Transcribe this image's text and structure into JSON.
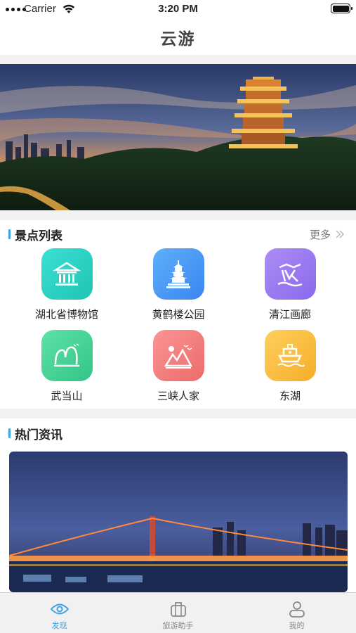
{
  "status_bar": {
    "carrier": "Carrier",
    "time": "3:20 PM"
  },
  "nav": {
    "title": "云游"
  },
  "banner": {
    "pages": 4,
    "active_page": 1
  },
  "attractions": {
    "title": "景点列表",
    "more_label": "更多",
    "items": [
      {
        "name": "湖北省博物馆",
        "icon": "museum-icon",
        "color": "#2fd3c6"
      },
      {
        "name": "黄鹤楼公园",
        "icon": "pagoda-icon",
        "color": "#4a9bf5"
      },
      {
        "name": "清江画廊",
        "icon": "gallery-icon",
        "color": "#9b7bf0"
      },
      {
        "name": "武当山",
        "icon": "mountain-icon",
        "color": "#48d39a"
      },
      {
        "name": "三峡人家",
        "icon": "gorge-icon",
        "color": "#f17d7d"
      },
      {
        "name": "东湖",
        "icon": "boat-icon",
        "color": "#fdbf3c"
      }
    ]
  },
  "news": {
    "title": "热门资讯"
  },
  "tab_bar": {
    "active": "发现",
    "tabs": [
      {
        "label": "发现",
        "icon": "eye-icon"
      },
      {
        "label": "旅游助手",
        "icon": "suitcase-icon"
      },
      {
        "label": "我的",
        "icon": "user-icon"
      }
    ]
  },
  "colors": {
    "accent": "#3ba3e6",
    "tab_bg": "#f1f1f1"
  }
}
